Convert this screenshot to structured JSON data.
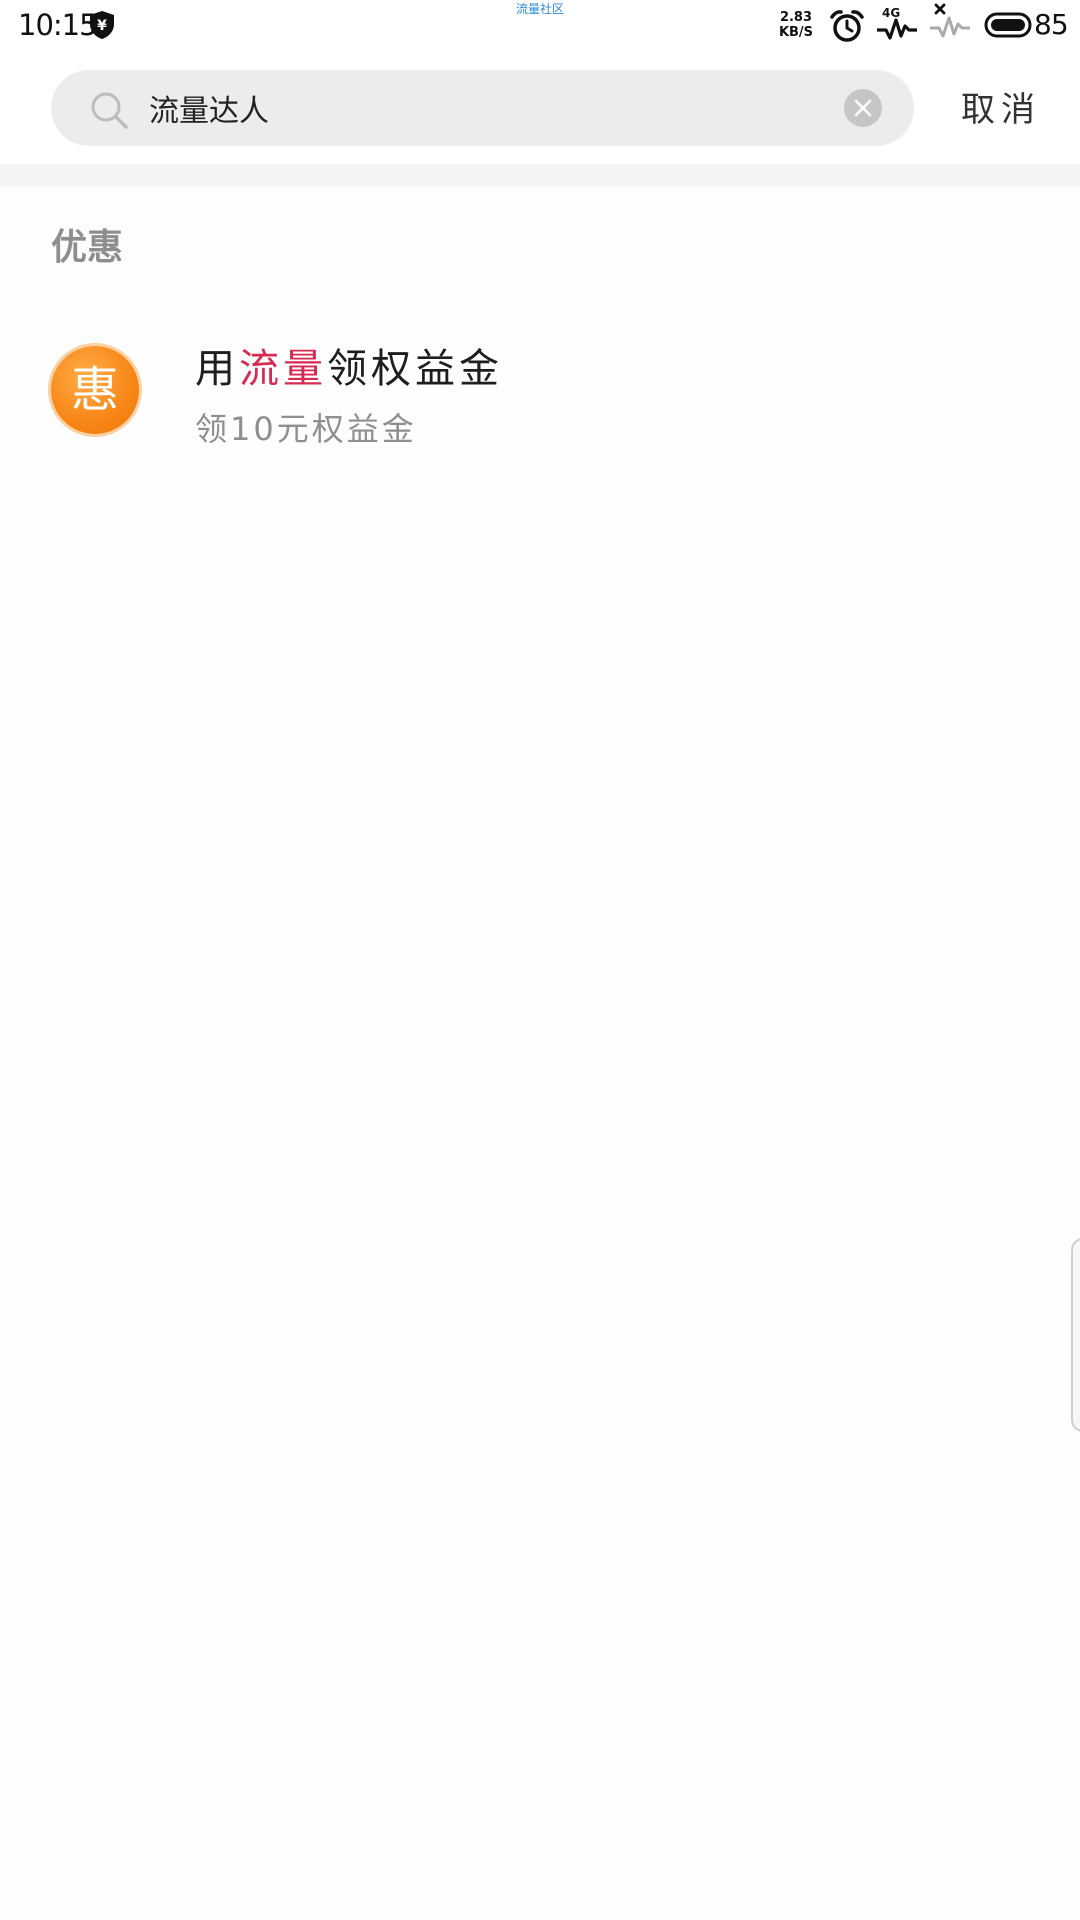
{
  "status_bar": {
    "time": "10:15",
    "center_text": "流量社区",
    "net_speed_value": "2.83",
    "net_speed_unit": "KB/S",
    "signal_tag": "4G",
    "battery_percent": "85"
  },
  "search": {
    "query": "流量达人",
    "cancel_label": "取消"
  },
  "results": {
    "section_title": "优惠",
    "items": [
      {
        "icon_text": "惠",
        "title_before": "用",
        "title_highlight": "流量",
        "title_after": "领权益金",
        "subtitle": "领10元权益金"
      }
    ]
  },
  "colors": {
    "highlight": "#d72a52",
    "icon_orange": "#f78616",
    "section_gray": "#8e8e8e"
  }
}
